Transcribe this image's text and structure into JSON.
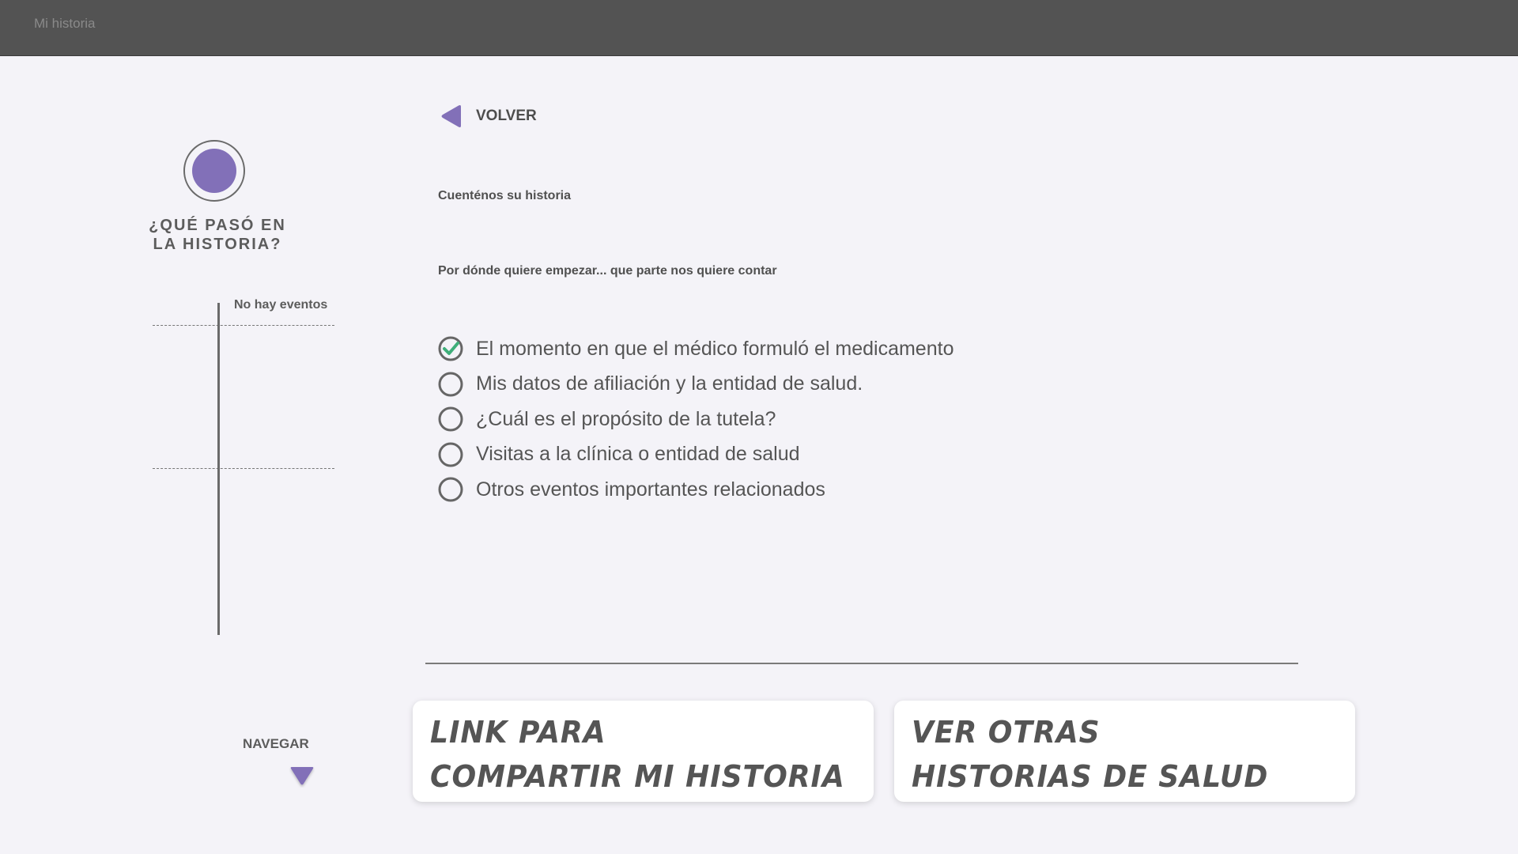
{
  "app": {
    "title": "Mi historia"
  },
  "colors": {
    "accent": "#8270b8",
    "check": "#3fae7a",
    "topbar": "#535353",
    "background": "#f4f3f8"
  },
  "sidebar": {
    "title": "¿QUÉ PASÓ EN LA HISTORIA?",
    "timeline_empty": "No hay eventos",
    "navigate_label": "NAVEGAR",
    "navigate_icon": "triangle-down-icon"
  },
  "main": {
    "back_label": "VOLVER",
    "back_icon": "triangle-left-icon",
    "prompt_title": "Cuenténos su historia",
    "prompt_sub": "Por dónde quiere empezar... que parte nos quiere contar",
    "options": [
      {
        "label": "El momento en que el médico formuló el medicamento",
        "checked": true
      },
      {
        "label": "Mis datos de afiliación y la entidad de salud.",
        "checked": false
      },
      {
        "label": "¿Cuál es el propósito de la tutela?",
        "checked": false
      },
      {
        "label": "Visitas a la clínica o entidad de salud",
        "checked": false
      },
      {
        "label": "Otros eventos importantes relacionados",
        "checked": false
      }
    ]
  },
  "cards": {
    "share": {
      "line1": "LINK PARA",
      "line2": "COMPARTIR MI HISTORIA"
    },
    "others": {
      "line1": "VER OTRAS",
      "line2": "HISTORIAS DE SALUD"
    }
  }
}
